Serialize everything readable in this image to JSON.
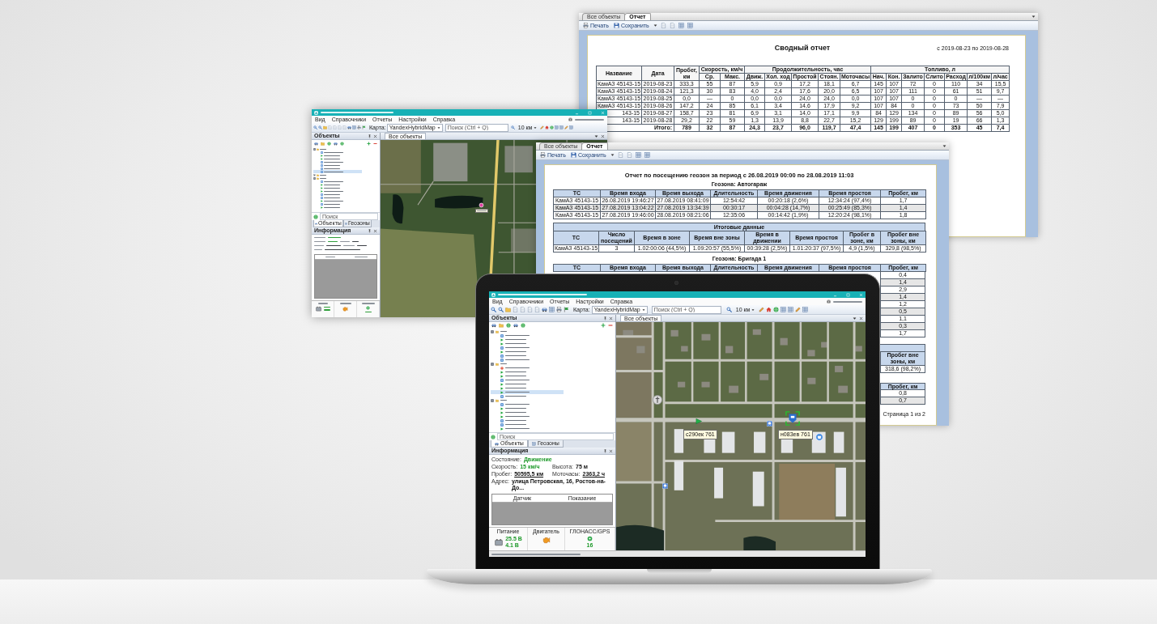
{
  "report_summary": {
    "tabs": [
      {
        "label": "Все объекты",
        "selected": false
      },
      {
        "label": "Отчет",
        "selected": true
      }
    ],
    "toolbar": [
      {
        "kind": "print",
        "label": "Печать"
      },
      {
        "kind": "save",
        "label": "Сохранить"
      }
    ],
    "title": "Сводный отчет",
    "period": "с 2019-08-23 по 2019-08-28",
    "columns": [
      {
        "label": "Название"
      },
      {
        "label": "Дата"
      },
      {
        "label": "Пробег, км"
      },
      {
        "label": "Скорость, км/ч",
        "colspan": 2,
        "sub": [
          "Ср.",
          "Макс."
        ]
      },
      {
        "label": "Продолжительность, час",
        "colspan": 5,
        "sub": [
          "Движ.",
          "Хол. ход",
          "Простой",
          "Стоян.",
          "Моточасы"
        ]
      },
      {
        "label": "Топливо, л",
        "colspan": 7,
        "sub": [
          "Нач.",
          "Кон.",
          "Залито",
          "Слито",
          "Расход",
          "л/100км",
          "л/час"
        ]
      }
    ],
    "rows": [
      [
        "КамАЗ 45143-15",
        "2019-08-23",
        "333,3",
        "55",
        "87",
        "5,9",
        "0,9",
        "17,2",
        "18,1",
        "6,7",
        "145",
        "107",
        "72",
        "0",
        "110",
        "34",
        "15,5"
      ],
      [
        "КамАЗ 45143-15",
        "2019-08-24",
        "121,3",
        "30",
        "83",
        "4,0",
        "2,4",
        "17,6",
        "20,0",
        "6,5",
        "107",
        "107",
        "111",
        "0",
        "61",
        "51",
        "9,7"
      ],
      [
        "КамАЗ 45143-15",
        "2019-08-25",
        "0,0",
        "—",
        "0",
        "0,0",
        "0,0",
        "24,0",
        "24,0",
        "0,0",
        "107",
        "107",
        "0",
        "0",
        "0",
        "—",
        "—"
      ],
      [
        "КамАЗ 45143-15",
        "2019-08-26",
        "147,2",
        "24",
        "85",
        "6,1",
        "3,4",
        "14,6",
        "17,9",
        "9,2",
        "107",
        "84",
        "0",
        "0",
        "73",
        "50",
        "7,9"
      ],
      [
        "143-15",
        "2019-08-27",
        "158,7",
        "23",
        "81",
        "6,9",
        "3,1",
        "14,0",
        "17,1",
        "9,9",
        "84",
        "129",
        "134",
        "0",
        "89",
        "56",
        "5,0"
      ],
      [
        "143-15",
        "2019-08-28",
        "29,2",
        "22",
        "59",
        "1,3",
        "13,9",
        "8,8",
        "22,7",
        "15,2",
        "129",
        "199",
        "89",
        "0",
        "19",
        "66",
        "1,3"
      ]
    ],
    "total": {
      "label": "Итого:",
      "values": [
        "789",
        "32",
        "87",
        "24,3",
        "23,7",
        "96,0",
        "119,7",
        "47,4",
        "145",
        "199",
        "407",
        "0",
        "353",
        "45",
        "7,4"
      ]
    }
  },
  "background_app": {
    "menu": [
      "Вид",
      "Справочники",
      "Отчеты",
      "Настройки",
      "Справка"
    ],
    "map_label": "Карта:",
    "map_source": "YandexHybridMap",
    "search_placeholder": "Поиск (Ctrl + Q)",
    "scale": "10 км",
    "objects_title": "Объекты",
    "tree": [
      {
        "expanded": true,
        "selected": false,
        "children": [
          {
            "kind": "parked",
            "selected": false
          },
          {
            "kind": "moving",
            "selected": false
          },
          {
            "kind": "moving",
            "selected": false
          },
          {
            "kind": "parked",
            "selected": false
          },
          {
            "kind": "parked",
            "selected": false
          },
          {
            "kind": "parked",
            "selected": false
          },
          {
            "kind": "parked",
            "selected": true
          }
        ]
      },
      {
        "expanded": false,
        "selected": false
      },
      {
        "expanded": true,
        "selected": false,
        "children": [
          {
            "kind": "parked",
            "selected": false
          },
          {
            "kind": "moving",
            "selected": false
          },
          {
            "kind": "moving",
            "selected": false
          },
          {
            "kind": "moving",
            "selected": false
          },
          {
            "kind": "parked",
            "selected": false
          },
          {
            "kind": "parked",
            "selected": false
          },
          {
            "kind": "moving",
            "selected": false
          },
          {
            "kind": "parked",
            "selected": false
          },
          {
            "kind": "moving",
            "selected": false
          }
        ]
      }
    ],
    "tree_search_placeholder": "Поиск",
    "panel_tabs": [
      {
        "label": "Объекты",
        "selected": true
      },
      {
        "label": "Геозоны",
        "selected": false
      }
    ],
    "info_title": "Информация",
    "map_tab": "Все объекты",
    "vehicles": [
      {
        "kind": "dot",
        "selected": false
      }
    ]
  },
  "report_geozones": {
    "tabs": [
      {
        "label": "Все объекты",
        "selected": false
      },
      {
        "label": "Отчет",
        "selected": true
      }
    ],
    "toolbar": [
      {
        "kind": "print",
        "label": "Печать"
      },
      {
        "kind": "save",
        "label": "Сохранить"
      }
    ],
    "title": "Отчет по посещению геозон за период с 26.08.2019 00:00 по 28.08.2019 11:03",
    "zone_1": {
      "heading": "Геозона: Автогараж",
      "columns": [
        "ТС",
        "Время входа",
        "Время выхода",
        "Длительность",
        "Время движения",
        "Время простоя",
        "Пробег, км"
      ],
      "rows": [
        [
          "КамАЗ 45143-15",
          "26.08.2019 19:46:27",
          "27.08.2019 08:41:09",
          "12:54:42",
          "00:20:18 (2,6%)",
          "12:34:24 (97,4%)",
          "1,7"
        ],
        [
          "КамАЗ 45143-15",
          "27.08.2019 13:04:22",
          "27.08.2019 13:34:39",
          "00:30:17",
          "00:04:28 (14,7%)",
          "00:25:49 (85,3%)",
          "1,4"
        ],
        [
          "КамАЗ 45143-15",
          "27.08.2019 19:46:00",
          "28.08.2019 08:21:06",
          "12:35:06",
          "00:14:42 (1,9%)",
          "12:20:24 (98,1%)",
          "1,8"
        ]
      ]
    },
    "summary": {
      "heading": "Итоговые данные",
      "columns": [
        "ТС",
        "Число посещений",
        "Время в зоне",
        "Время вне зоны",
        "Время в движении",
        "Время простоя",
        "Пробег в зоне, км",
        "Пробег вне зоны, км"
      ],
      "rows": [
        [
          "КамАЗ 45143-15",
          "3",
          "1.02:00:06 (44,5%)",
          "1.09:20:57 (55,5%)",
          "00:39:28 (2,5%)",
          "1.01:20:37 (97,5%)",
          "4,9 (1,5%)",
          "329,8 (98,5%)"
        ]
      ]
    },
    "zone_2": {
      "heading": "Геозона: Бригада 1",
      "columns": [
        "ТС",
        "Время входа",
        "Время выхода",
        "Длительность",
        "Время движения",
        "Время простоя",
        "Пробег, км"
      ],
      "mileage": [
        "0,4",
        "1,4",
        "2,9",
        "1,4",
        "1,2",
        "0,5",
        "1,1",
        "0,3",
        "1,7"
      ]
    },
    "summary_2": {
      "last_column": "Пробег вне зоны, км",
      "last_value": "318,6 (98,2%)"
    },
    "zone_3": {
      "last_column": "Пробег, км",
      "mileage": [
        "0,8",
        "0,7"
      ]
    },
    "page_number": "Страница 1 из 2"
  },
  "laptop": {
    "app": {
      "menu": [
        "Вид",
        "Справочники",
        "Отчеты",
        "Настройки",
        "Справка"
      ],
      "map_label": "Карта:",
      "map_source": "YandexHybridMap",
      "search_placeholder": "Поиск (Ctrl + Q)",
      "scale": "10 км",
      "objects_title": "Объекты",
      "tree": [
        {
          "expanded": true,
          "selected": false,
          "children": [
            {
              "kind": "parked",
              "selected": false
            },
            {
              "kind": "moving",
              "selected": false
            },
            {
              "kind": "moving",
              "selected": false
            },
            {
              "kind": "parked",
              "selected": false
            },
            {
              "kind": "moving",
              "selected": false
            },
            {
              "kind": "parked",
              "selected": false
            },
            {
              "kind": "parked",
              "selected": false
            }
          ]
        },
        {
          "expanded": true,
          "selected": false,
          "children": [
            {
              "kind": "alert",
              "selected": false
            },
            {
              "kind": "moving",
              "selected": false
            },
            {
              "kind": "moving",
              "selected": false
            },
            {
              "kind": "parked",
              "selected": false
            },
            {
              "kind": "moving",
              "selected": false
            },
            {
              "kind": "moving",
              "selected": false
            },
            {
              "kind": "moving",
              "selected": true
            },
            {
              "kind": "parked",
              "selected": false
            }
          ]
        },
        {
          "expanded": true,
          "selected": false,
          "children": [
            {
              "kind": "parked",
              "selected": false
            },
            {
              "kind": "moving",
              "selected": false
            },
            {
              "kind": "moving",
              "selected": false
            },
            {
              "kind": "moving",
              "selected": false
            },
            {
              "kind": "parked",
              "selected": false
            },
            {
              "kind": "parked",
              "selected": false
            },
            {
              "kind": "moving",
              "selected": false
            }
          ]
        }
      ],
      "tree_search_placeholder": "Поиск",
      "panel_tabs": [
        {
          "label": "Объекты",
          "selected": true
        },
        {
          "label": "Геозоны",
          "selected": false
        }
      ],
      "info_title": "Информация",
      "info_rows": [
        [
          {
            "label": "Состояние:",
            "value": "Движение",
            "kind": "status"
          }
        ],
        [
          {
            "label": "Скорость:",
            "value": "15 км/ч",
            "kind": "status"
          },
          {
            "label": "Высота:",
            "value": "75 м",
            "kind": "plain"
          }
        ],
        [
          {
            "label": "Пробег:",
            "value": "50595,5 км",
            "kind": "link"
          },
          {
            "label": "Моточасы:",
            "value": "2363,2 ч",
            "kind": "link"
          }
        ],
        [
          {
            "label": "Адрес:",
            "value": "улица Петровская, 16, Ростов-на-До...",
            "kind": "plain"
          }
        ]
      ],
      "sensor_columns": [
        "Датчик",
        "Показание"
      ],
      "power": {
        "label": "Питание",
        "values": [
          "25.5 В",
          "4.1 В"
        ]
      },
      "engine": {
        "label": "Двигатель"
      },
      "gnss": {
        "label": "ГЛОНАСС/GPS",
        "value": "16"
      },
      "map_tab": "Все объекты",
      "vehicles": [
        {
          "label": "с290ек 761",
          "kind": "moving",
          "selected": false
        },
        {
          "label": "н083ев 761",
          "kind": "parked",
          "selected": true
        }
      ]
    }
  }
}
